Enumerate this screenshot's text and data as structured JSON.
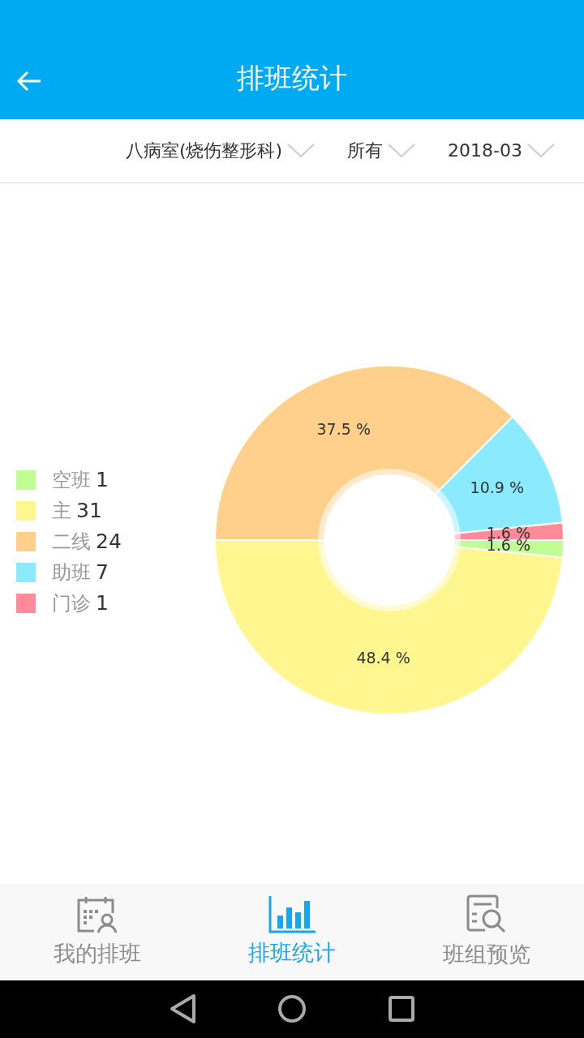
{
  "header": {
    "title": "排班统计"
  },
  "filters": [
    {
      "label": "八病室(烧伤整形科)"
    },
    {
      "label": "所有"
    },
    {
      "label": "2018-03"
    }
  ],
  "legend": [
    {
      "count": "1",
      "color": "#c1fd95"
    },
    {
      "count": "31",
      "color": "#fff68f"
    },
    {
      "count": "24",
      "color": "#ffd08c"
    },
    {
      "count": "7",
      "color": "#8ceafe"
    },
    {
      "count": "1",
      "color": "#ff8b9a"
    }
  ],
  "chart_data": {
    "type": "donut",
    "categories": [
      "空班",
      "主",
      "二线",
      "助班",
      "门诊"
    ],
    "values": [
      1.6,
      48.4,
      37.5,
      10.9,
      1.6
    ],
    "value_labels": [
      "1.6 %",
      "48.4 %",
      "37.5 %",
      "10.9 %",
      "1.6 %"
    ]
  },
  "tabs": [
    {
      "label": "我的排班",
      "selected": false
    },
    {
      "label": "排班统计",
      "selected": true
    },
    {
      "label": "班组预览",
      "selected": false
    }
  ]
}
